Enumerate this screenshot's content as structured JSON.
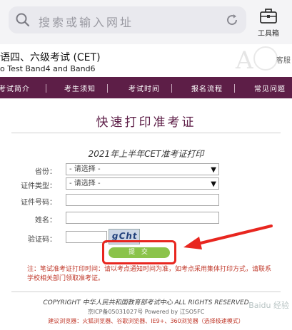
{
  "browser": {
    "search_placeholder": "搜索或输入网址",
    "toolbox_label": "工具箱"
  },
  "header": {
    "title": "语四、六级考试 (CET)",
    "subtitle": "o Test Band4 and Band6",
    "right_text": "客服"
  },
  "nav": {
    "items": [
      "考试简介",
      "考生须知",
      "考试时间",
      "报名流程",
      "常见问题"
    ]
  },
  "page": {
    "title": "快速打印准考证",
    "form_title": "2021年上半年CET准考证打印"
  },
  "form": {
    "province_label": "省份：",
    "province_value": "- 请选择 -",
    "id_type_label": "证件类型：",
    "id_type_value": "- 请选择 -",
    "id_number_label": "证件号码：",
    "name_label": "姓名：",
    "captcha_label": "验证码：",
    "captcha_text": "gCht",
    "submit_label": "提 交"
  },
  "note": "注：笔试准考证打印时间：请以考点通知时间为准，如考点采用集体打印方式，请联系学校相关部门领取准考证。",
  "footer": {
    "copyright": "COPYRIGHT 中华人民共和国教育部考试中心 ALL RIGHTS RESERVED",
    "icp": "京ICP备05031027号 Powered by 江SO5FC",
    "browsers": "建议浏览器：火狐浏览器、谷歌浏览器、IE9+、360浏览器（选择极速模式）",
    "watermark": "Baidu 经验"
  },
  "colors": {
    "nav_bg": "#5d1e47",
    "submit_bg": "#8bc34a",
    "highlight": "#e8261f",
    "note": "#c0392b"
  }
}
